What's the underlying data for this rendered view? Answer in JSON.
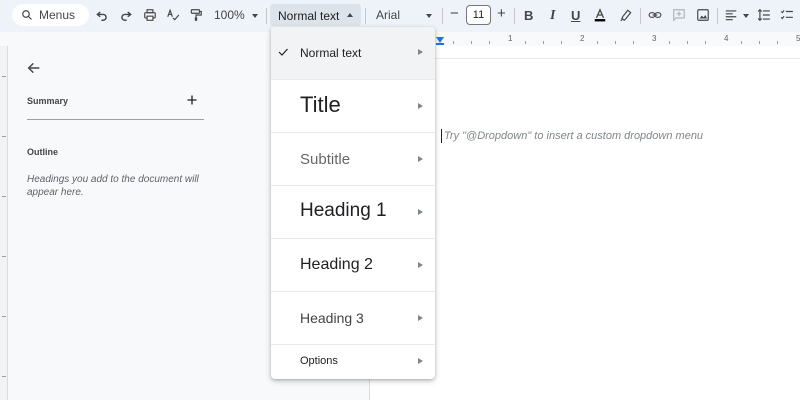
{
  "toolbar": {
    "menus_label": "Menus",
    "zoom": "100%",
    "style": "Normal text",
    "font": "Arial",
    "font_size": "11",
    "bold": "B",
    "italic": "I",
    "underline": "U",
    "minus": "−",
    "plus": "+"
  },
  "sidebar": {
    "summary_label": "Summary",
    "outline_label": "Outline",
    "outline_hint": "Headings you add to the document will appear here."
  },
  "ruler": {
    "numbers": [
      "1",
      "2",
      "3",
      "4",
      "5"
    ]
  },
  "document": {
    "placeholder": "Try \"@Dropdown\" to insert a custom dropdown menu"
  },
  "dropdown": {
    "items": [
      {
        "label": "Normal text",
        "selected": true
      },
      {
        "label": "Title",
        "selected": false
      },
      {
        "label": "Subtitle",
        "selected": false
      },
      {
        "label": "Heading 1",
        "selected": false
      },
      {
        "label": "Heading 2",
        "selected": false
      },
      {
        "label": "Heading 3",
        "selected": false
      },
      {
        "label": "Options",
        "selected": false
      }
    ]
  },
  "colors": {
    "accent": "#1a73e8",
    "toolbar_bg": "#eef2f9",
    "selected_bg": "#f1f3f4"
  }
}
